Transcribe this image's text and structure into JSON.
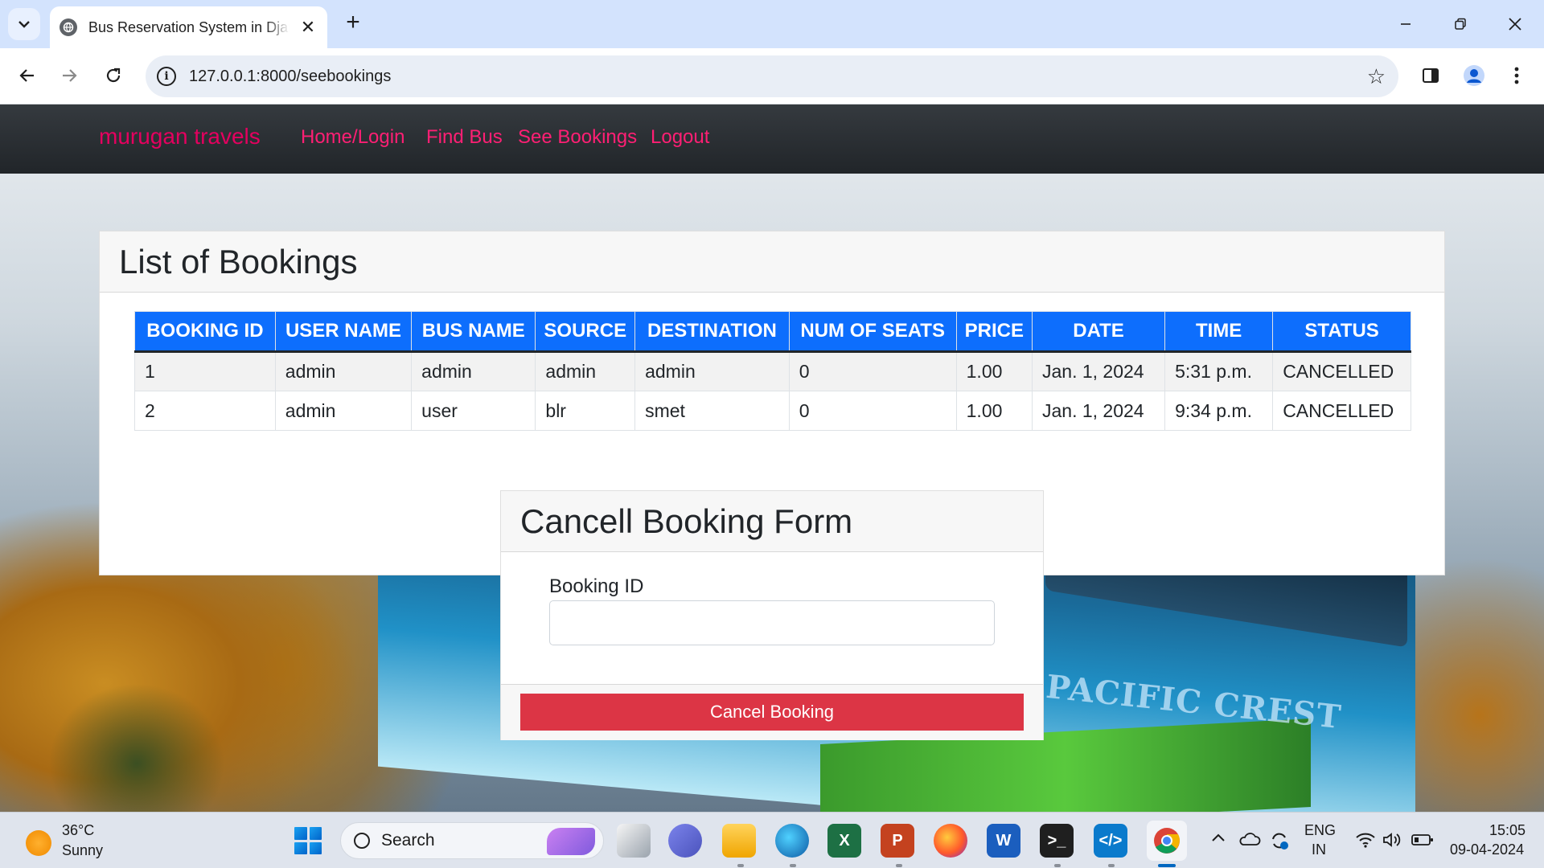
{
  "browser": {
    "tab_title": "Bus Reservation System in Django",
    "new_tab": "+",
    "tab_close": "✕",
    "url": "127.0.0.1:8000/seebookings"
  },
  "site": {
    "brand": "murugan travels",
    "nav": [
      "Home/Login",
      "Find Bus",
      "See Bookings",
      "Logout"
    ]
  },
  "bookings": {
    "title": "List of Bookings",
    "columns": [
      "BOOKING ID",
      "USER NAME",
      "BUS NAME",
      "SOURCE",
      "DESTINATION",
      "NUM OF SEATS",
      "PRICE",
      "DATE",
      "TIME",
      "STATUS"
    ],
    "rows": [
      [
        "1",
        "admin",
        "admin",
        "admin",
        "admin",
        "0",
        "1.00",
        "Jan. 1, 2024",
        "5:31 p.m.",
        "CANCELLED"
      ],
      [
        "2",
        "admin",
        "user",
        "blr",
        "smet",
        "0",
        "1.00",
        "Jan. 1, 2024",
        "9:34 p.m.",
        "CANCELLED"
      ]
    ]
  },
  "cancel_form": {
    "title": "Cancell Booking Form",
    "field_label": "Booking ID",
    "field_value": "",
    "button_label": "Cancel Booking"
  },
  "background": {
    "bus_logo_text": "PACIFIC CREST"
  },
  "taskbar": {
    "weather_temp": "36°C",
    "weather_condition": "Sunny",
    "search_label": "Search",
    "language_line1": "ENG",
    "language_line2": "IN",
    "time": "15:05",
    "date": "09-04-2024",
    "apps": [
      "file-explorer-icon",
      "teams-icon",
      "folder-icon",
      "edge-icon",
      "excel-icon",
      "powerpoint-icon",
      "firefox-icon",
      "word-icon",
      "terminal-icon",
      "vscode-icon",
      "chrome-icon"
    ]
  },
  "colors": {
    "table_header": "#0d6efd",
    "brand_pink": "#e4005f",
    "danger_button": "#dc3545",
    "navbar": "#212529"
  }
}
